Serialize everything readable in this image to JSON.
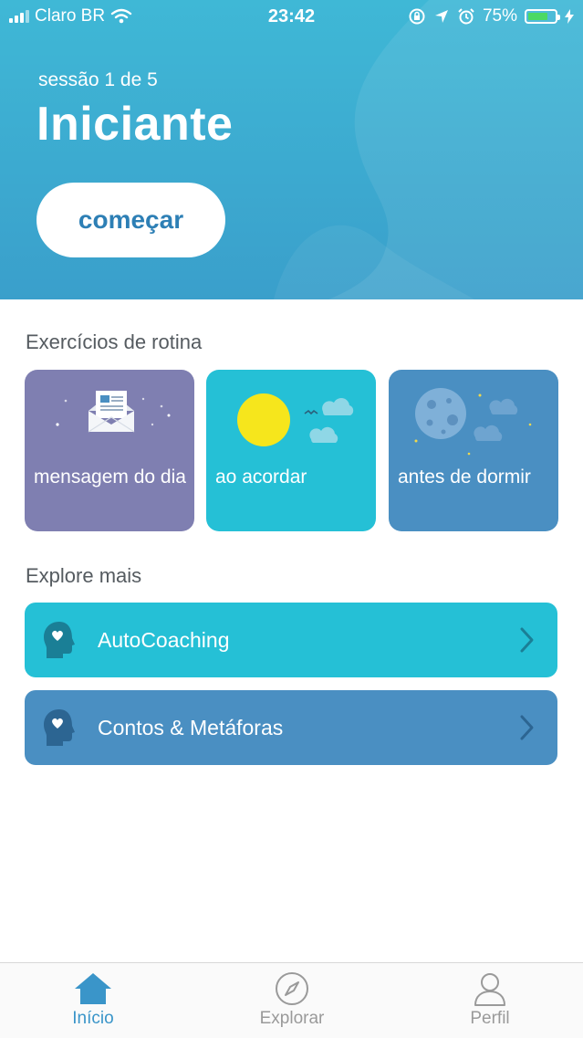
{
  "status_bar": {
    "carrier": "Claro BR",
    "time": "23:42",
    "battery": "75%",
    "battery_level": 0.75
  },
  "hero": {
    "session": "sessão 1 de 5",
    "level_title": "Iniciante",
    "start_label": "começar"
  },
  "routine": {
    "title": "Exercícios de rotina",
    "cards": [
      {
        "label": "mensagem do dia",
        "color": "#7f7fb1",
        "icon": "envelope-icon"
      },
      {
        "label": "ao acordar",
        "color": "#25c0d6",
        "icon": "sun-icon"
      },
      {
        "label": "antes de dormir",
        "color": "#4a8fc2",
        "icon": "moon-icon"
      }
    ]
  },
  "explore": {
    "title": "Explore mais",
    "items": [
      {
        "label": "AutoCoaching",
        "color": "#25c0d6",
        "icon": "head-heart-icon"
      },
      {
        "label": "Contos & Metáforas",
        "color": "#4a8fc2",
        "icon": "head-heart-icon"
      }
    ]
  },
  "tabbar": {
    "tabs": [
      {
        "label": "Início",
        "icon": "home-icon",
        "active": true
      },
      {
        "label": "Explorar",
        "icon": "compass-icon",
        "active": false
      },
      {
        "label": "Perfil",
        "icon": "person-icon",
        "active": false
      }
    ],
    "active_color": "#3a95c9",
    "inactive_color": "#9a9a9a"
  }
}
